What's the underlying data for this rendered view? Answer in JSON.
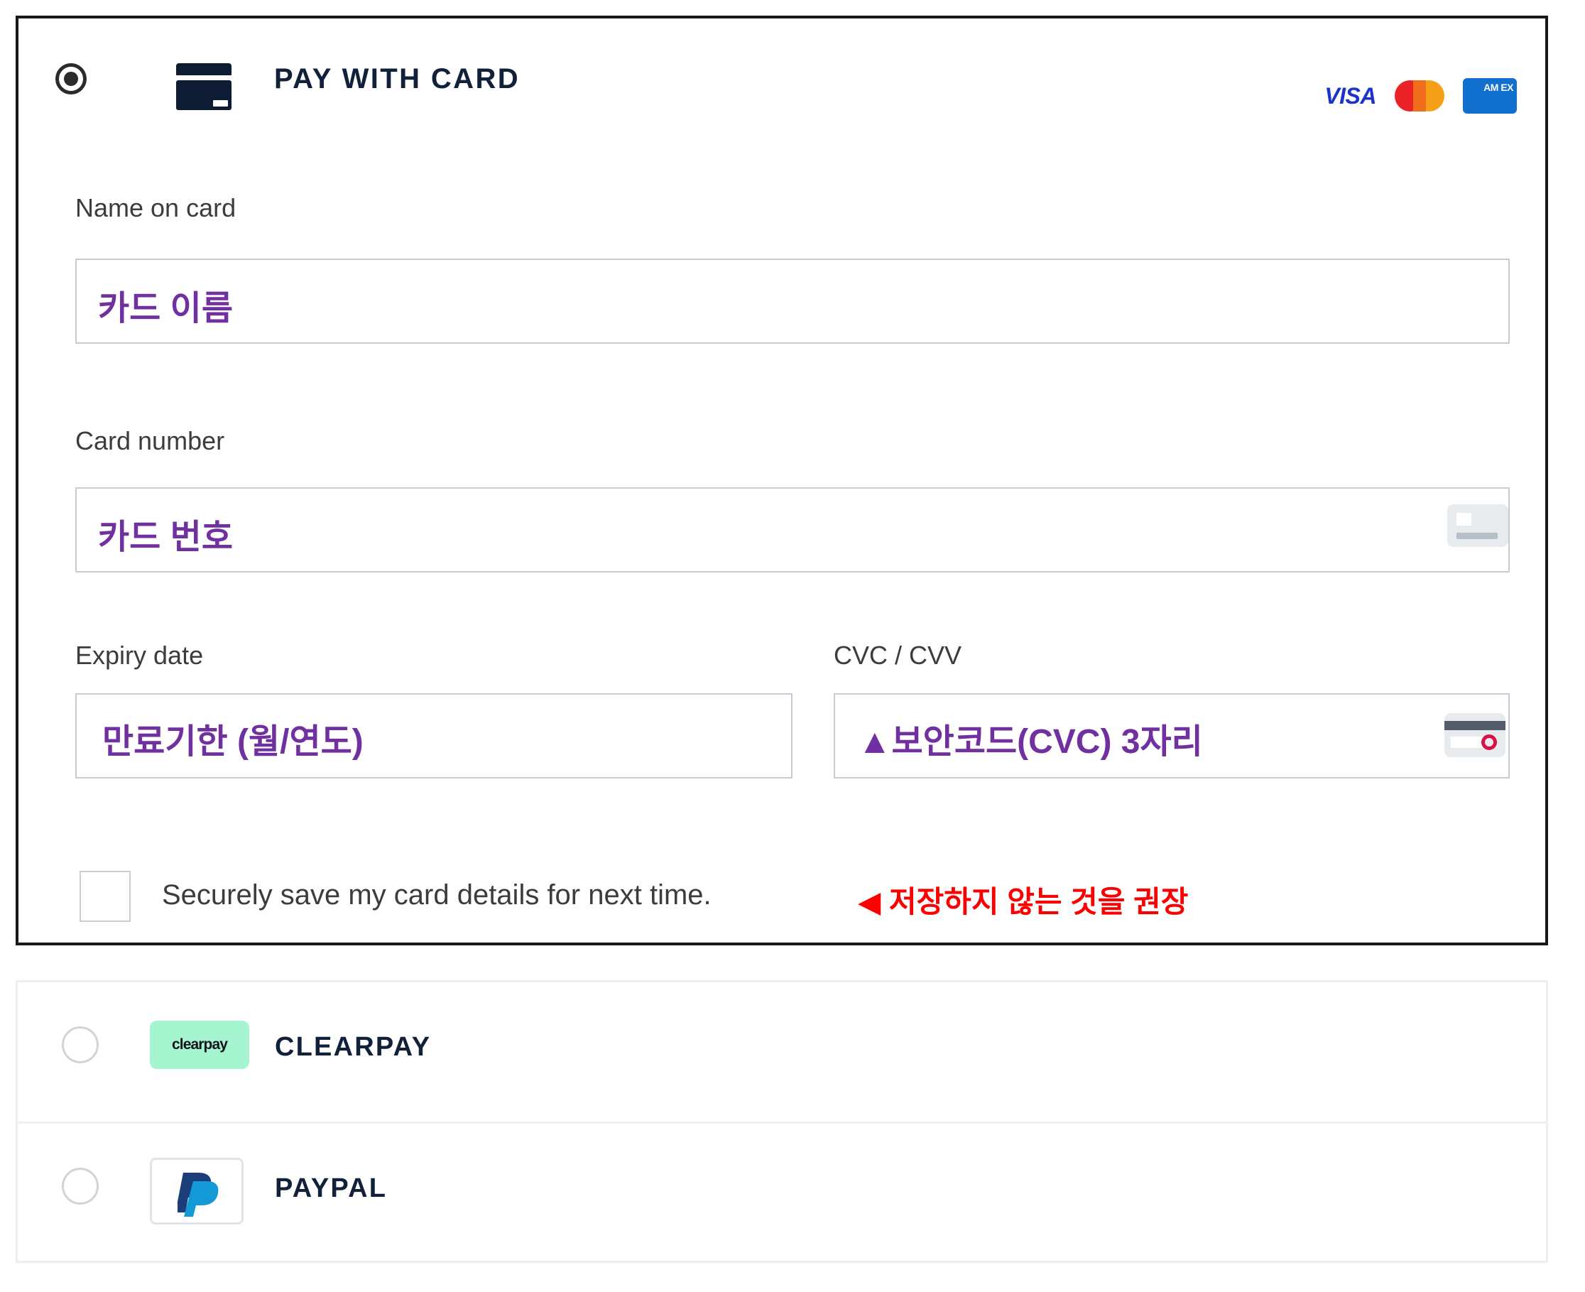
{
  "colors": {
    "accent_purple": "#7030A0",
    "warning_red": "#FA0000",
    "dark_navy": "#12213A",
    "visa_blue": "#1A34C8",
    "mastercard_red": "#EB2326",
    "mastercard_orange": "#F6A01A",
    "amex_blue": "#1170CE",
    "clearpay_mint": "#A4F5D0",
    "paypal_navy": "#1B3E79",
    "paypal_lightblue": "#139AD6",
    "panel_border": "#17171C",
    "field_border": "#C5CCD4"
  },
  "card_panel": {
    "radio": {
      "name": "pay-with-card-radio",
      "selected": true
    },
    "title": "PAY WITH CARD",
    "card_icon": "credit-card-icon",
    "brands": [
      {
        "name": "visa",
        "label": "VISA"
      },
      {
        "name": "mastercard",
        "label": ""
      },
      {
        "name": "amex",
        "label": "AM EX"
      }
    ],
    "fields": [
      {
        "key": "name_on_card",
        "label": "Name on card",
        "value": "카드 이름",
        "placeholder": "카드 이름",
        "icon": null
      },
      {
        "key": "card_number",
        "label": "Card number",
        "value": "카드 번호",
        "placeholder": "카드 번호",
        "icon": "card-front-icon"
      },
      {
        "key": "expiry_date",
        "label": "Expiry date",
        "value": "만료기한 (월/연도)",
        "placeholder": "만료기한 (월/연도)",
        "icon": null
      },
      {
        "key": "cvc",
        "label": "CVC / CVV",
        "value": "▲보안코드(CVC) 3자리",
        "placeholder": "▲보안코드(CVC) 3자리",
        "icon": "card-back-icon"
      }
    ],
    "save_card": {
      "checked": false,
      "label": "Securely save my card details for next time.",
      "annotation": "◀ 저장하지 않는 것을 권장"
    }
  },
  "alt_payments": {
    "options": [
      {
        "key": "clearpay",
        "label": "CLEARPAY",
        "badge_text": "clearpay",
        "selected": false
      },
      {
        "key": "paypal",
        "label": "PAYPAL",
        "badge_text": "",
        "selected": false
      }
    ]
  }
}
